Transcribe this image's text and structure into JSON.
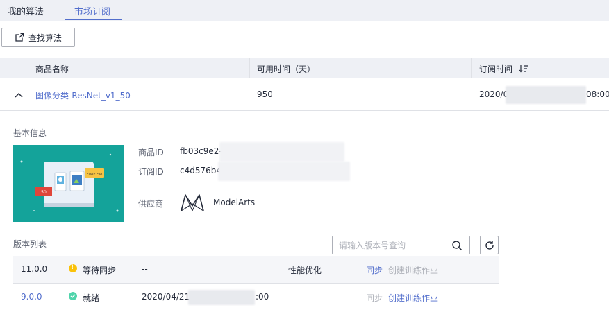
{
  "tabs": [
    {
      "label": "我的算法",
      "active": false
    },
    {
      "label": "市场订阅",
      "active": true
    }
  ],
  "toolbar": {
    "find_label": "查找算法"
  },
  "table": {
    "columns": [
      "商品名称",
      "可用时间（天）",
      "订阅时间"
    ],
    "row": {
      "name": "图像分类-ResNet_v1_50",
      "days": "950",
      "time_prefix": "2020/0",
      "time_suffix": "08:00"
    }
  },
  "basic_info": {
    "title": "基本信息",
    "product_id_label": "商品ID",
    "product_id_value": "fb03c9e2-",
    "order_id_label": "订阅ID",
    "order_id_value": "c4d576b4",
    "vendor_label": "供应商",
    "vendor_name": "ModelArts",
    "thumb_badge": "Flask File",
    "thumb_tag": "50"
  },
  "versions": {
    "title": "版本列表",
    "search_placeholder": "请输入版本号查询",
    "rows": [
      {
        "version": "11.0.0",
        "status": "等待同步",
        "status_color": "#fac20a",
        "created": "--",
        "created_suffix": "",
        "desc": "性能优化",
        "action1": "同步",
        "action2": "创建训练作业"
      },
      {
        "version": "9.0.0",
        "status": "就绪",
        "status_color": "#50d4ab",
        "created": "2020/04/21",
        "created_suffix": ":00",
        "desc": "--",
        "action1": "同步",
        "action2": "创建训练作业"
      }
    ]
  },
  "colors": {
    "accent": "#526ecc",
    "header_bg": "#eef0f5",
    "teal": "#14a39a"
  }
}
